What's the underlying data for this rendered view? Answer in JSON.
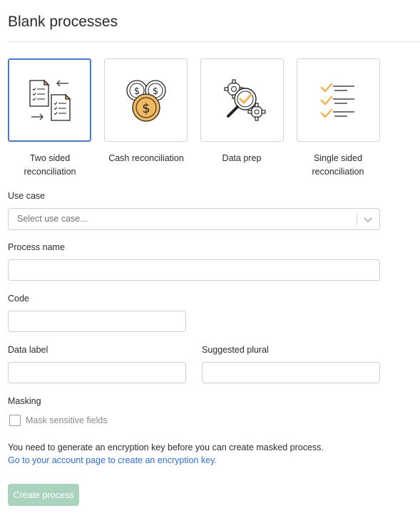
{
  "page": {
    "title": "Blank processes"
  },
  "process_types": [
    {
      "label_line1": "Two sided",
      "label_line2": "reconciliation",
      "icon": "two-documents-arrows-icon",
      "selected": true
    },
    {
      "label_line1": "Cash reconciliation",
      "label_line2": "",
      "icon": "coins-icon",
      "selected": false
    },
    {
      "label_line1": "Data prep",
      "label_line2": "",
      "icon": "gears-magnifier-icon",
      "selected": false
    },
    {
      "label_line1": "Single sided",
      "label_line2": "reconciliation",
      "icon": "checklist-icon",
      "selected": false
    }
  ],
  "form": {
    "use_case": {
      "label": "Use case",
      "placeholder": "Select use case..."
    },
    "process_name": {
      "label": "Process name",
      "value": ""
    },
    "code": {
      "label": "Code",
      "value": ""
    },
    "data_label": {
      "label": "Data label",
      "value": ""
    },
    "suggested_plural": {
      "label": "Suggested plural",
      "value": ""
    },
    "masking": {
      "label": "Masking",
      "checkbox_label": "Mask sensitive fields",
      "checked": false
    }
  },
  "notice": {
    "text": "You need to generate an encryption key before you can create masked process.",
    "link_text": "Go to your account page to create an encryption key."
  },
  "actions": {
    "create_label": "Create process"
  },
  "colors": {
    "accent_blue": "#4a78c8",
    "link_blue": "#2e6fd6",
    "icon_orange": "#f0b860",
    "button_disabled_green": "#a9d3bd"
  }
}
